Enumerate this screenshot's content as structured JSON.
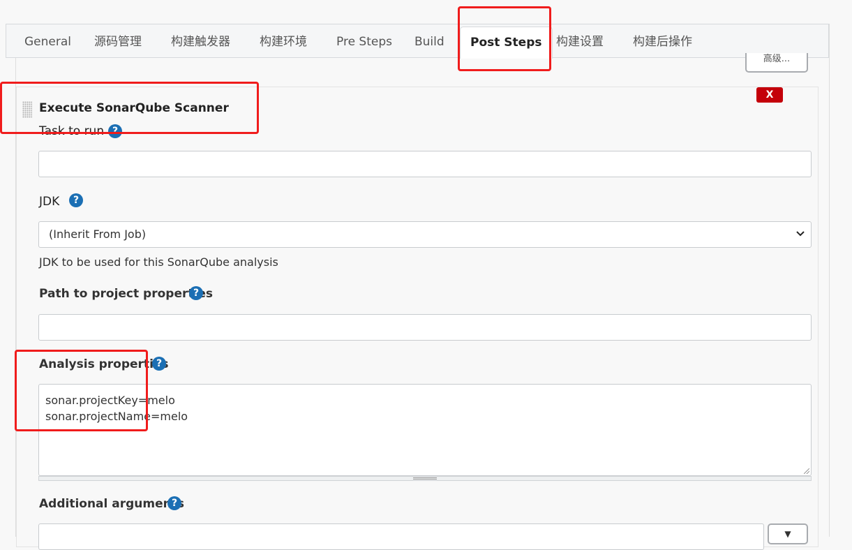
{
  "tabs": [
    {
      "label": "General"
    },
    {
      "label": "源码管理"
    },
    {
      "label": "构建触发器"
    },
    {
      "label": "构建环境"
    },
    {
      "label": "Pre Steps"
    },
    {
      "label": "Build"
    },
    {
      "label": "Post Steps",
      "active": true
    },
    {
      "label": "构建设置"
    },
    {
      "label": "构建后操作"
    }
  ],
  "advanced_button": "高级...",
  "section": {
    "title": "Execute SonarQube Scanner",
    "delete_label": "X"
  },
  "fields": {
    "task_to_run": {
      "label": "Task to run",
      "value": ""
    },
    "jdk": {
      "label": "JDK",
      "selected": "(Inherit From Job)",
      "help": "JDK to be used for this SonarQube analysis"
    },
    "project_properties": {
      "label": "Path to project properties",
      "value": ""
    },
    "analysis_properties": {
      "label": "Analysis properties",
      "line1": "sonar.projectKey=melo",
      "line2": "sonar.projectName=melo"
    },
    "additional_arguments": {
      "label": "Additional arguments",
      "value": ""
    }
  },
  "icons": {
    "help": "question-circle-icon",
    "dropdown": "caret-down-icon"
  },
  "colors": {
    "help_icon": "#1b6fb4",
    "delete_button": "#c4000a",
    "annotation": "#f01c1c"
  }
}
